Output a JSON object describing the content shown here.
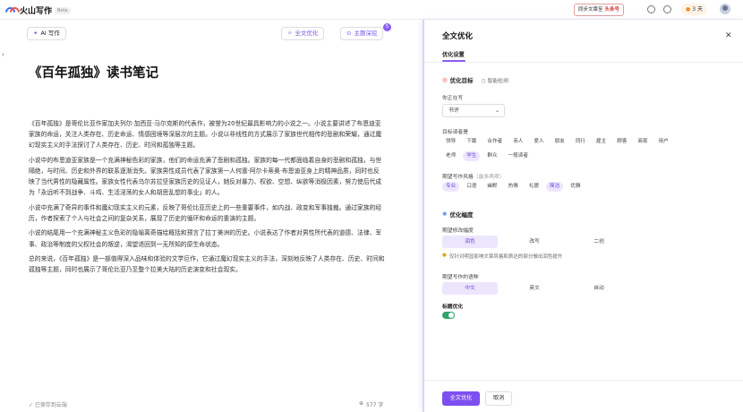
{
  "app": {
    "name": "火山写作",
    "beta": "Beta"
  },
  "topbar": {
    "sync_label": "同步文章至",
    "sync_target": "头条号",
    "streak_days": "3 天"
  },
  "editor": {
    "ai_button": "AI 写作",
    "tools": [
      {
        "label": "全文优化",
        "icon": "sparkle-icon"
      },
      {
        "label": "主题深挖",
        "icon": "location-pin-icon"
      }
    ],
    "badge_count": "5",
    "title": "《百年孤独》读书笔记",
    "paragraphs": [
      "《百年孤独》是哥伦比亚作家加夫列尔·加西亚·马尔克斯的代表作，被誉为20世纪最具影响力的小说之一。小说主要讲述了布恩迪亚家族的命运，关注人类存在、历史命运、情感困境等深层次的主题。小说以非线性的方式展示了家族世代相传的悲剧和荣耀，通过魔幻现实主义的手法探讨了人类存在、历史、时间和孤独等主题。",
      "小说中的布恩迪亚家族是一个充满神秘色彩的家族，他们的命运充满了悲剧和孤独。家族的每一代都面临着自身的悲剧和孤独，与世隔绝，与时间、历史和外界的联系逐渐消失。家族男性成员代表了家族第一人何塞·阿尔卡蒂奥·布恩迪亚身上的精神品质，同时也反映了当代男性的隐藏属性。家族女性代表乌尔苏拉坚家族历史的见证人，她反对暴力、权欲、空想、纵欲等消极因素，努力使后代成为「永远听不到战争、斗鸡、生活淫荡的女人和胡思乱想的事业」的人。",
      "小说中充满了奇异的事件和魔幻现实主义的元素，反映了哥伦比亚历史上的一些重要事件，如内战、政变和军事独裁。通过家族的经历，作者探索了个人与社会之间的复杂关系，展现了历史的循环和命运的重演的主题。",
      "小说的结尾用一个充满神秘主义色彩的隐喻离奇描绘概括和预言了拉丁美洲的历史。小说表达了作者对男性所代表的道德、法律、军事、政治等制度的父权社会的叛逆，渴望退回到一无所知的原生命状态。",
      "总的来说，《百年孤独》是一部值得深入品味和体验的文学巨作，它通过魔幻现实主义的手法，深刻地反映了人类存在、历史、时间和孤独等主题，同时也展示了哥伦比亚乃至整个拉美大陆的历史演变和社会现实。"
    ],
    "saved_text": "✓ 已保存到云端",
    "word_count": "577 字"
  },
  "panel": {
    "title": "全文优化",
    "tab": "优化设置",
    "goal_section": "优化目标",
    "smart_detect": "智能检测",
    "writing_label": "你正在写",
    "writing_value": "书评",
    "audience_label": "目标读者是",
    "audience_row1": [
      "领导",
      "下属",
      "合作者",
      "亲人",
      "爱人",
      "朋友",
      "同行",
      "雇主",
      "顾客",
      "商家",
      "用户"
    ],
    "audience_row2": [
      "老师",
      "学生",
      "群众",
      "一般读者"
    ],
    "audience_selected": "学生",
    "style_label": "期望写作风格",
    "style_hint": "（最多两项）",
    "styles": [
      "专业",
      "口语",
      "幽默",
      "热情",
      "礼貌",
      "简洁",
      "优雅"
    ],
    "styles_selected": [
      "专业",
      "简洁"
    ],
    "range_section": "优化幅度",
    "range_label": "期望修改幅度",
    "range_options": [
      "润色",
      "改写",
      "二创"
    ],
    "range_selected": "润色",
    "range_tip": "仅针对明显影响文章风格和表达的部分做出润色提升",
    "lang_label": "期望写作的语种",
    "lang_options": [
      "中文",
      "英文",
      "自动"
    ],
    "lang_selected": "中文",
    "title_opt_label": "标题优化",
    "title_opt_on": true,
    "confirm_button": "全文优化",
    "cancel_button": "取消"
  }
}
